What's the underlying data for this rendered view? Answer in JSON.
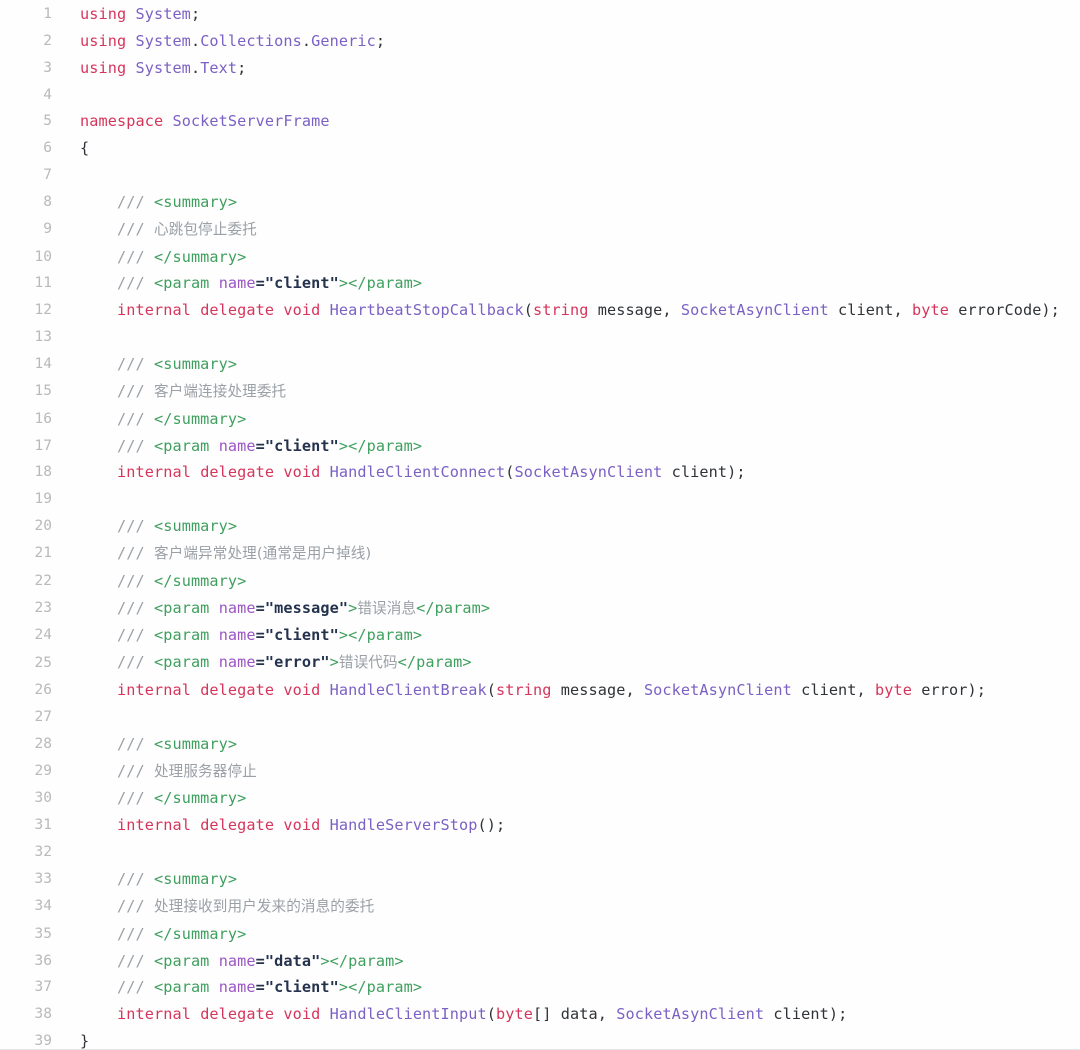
{
  "viewer": {
    "language": "csharp",
    "background": "#fefefe",
    "gutter_color": "#b9b9b9",
    "border_color": "#e4e4e4",
    "first_line": 1,
    "last_line": 39,
    "total_lines": 39
  },
  "colors": {
    "keyword": "#d6355b",
    "type": "#7b61c4",
    "punctuation": "#2f3337",
    "comment": "#9aa0a6",
    "doc_tag": "#3f9f5e",
    "doc_attribute": "#9b55c4",
    "string": "#24324d"
  },
  "lines": [
    {
      "n": "1",
      "text": "using System;"
    },
    {
      "n": "2",
      "text": "using System.Collections.Generic;"
    },
    {
      "n": "3",
      "text": "using System.Text;"
    },
    {
      "n": "4",
      "text": ""
    },
    {
      "n": "5",
      "text": "namespace SocketServerFrame"
    },
    {
      "n": "6",
      "text": "{"
    },
    {
      "n": "7",
      "text": ""
    },
    {
      "n": "8",
      "text": "    /// <summary>"
    },
    {
      "n": "9",
      "text": "    /// 心跳包停止委托"
    },
    {
      "n": "10",
      "text": "    /// </summary>"
    },
    {
      "n": "11",
      "text": "    /// <param name=\"client\"></param>"
    },
    {
      "n": "12",
      "text": "    internal delegate void HeartbeatStopCallback(string message, SocketAsynClient client, byte errorCode);"
    },
    {
      "n": "13",
      "text": ""
    },
    {
      "n": "14",
      "text": "    /// <summary>"
    },
    {
      "n": "15",
      "text": "    /// 客户端连接处理委托"
    },
    {
      "n": "16",
      "text": "    /// </summary>"
    },
    {
      "n": "17",
      "text": "    /// <param name=\"client\"></param>"
    },
    {
      "n": "18",
      "text": "    internal delegate void HandleClientConnect(SocketAsynClient client);"
    },
    {
      "n": "19",
      "text": ""
    },
    {
      "n": "20",
      "text": "    /// <summary>"
    },
    {
      "n": "21",
      "text": "    /// 客户端异常处理(通常是用户掉线)"
    },
    {
      "n": "22",
      "text": "    /// </summary>"
    },
    {
      "n": "23",
      "text": "    /// <param name=\"message\">错误消息</param>"
    },
    {
      "n": "24",
      "text": "    /// <param name=\"client\"></param>"
    },
    {
      "n": "25",
      "text": "    /// <param name=\"error\">错误代码</param>"
    },
    {
      "n": "26",
      "text": "    internal delegate void HandleClientBreak(string message, SocketAsynClient client, byte error);"
    },
    {
      "n": "27",
      "text": ""
    },
    {
      "n": "28",
      "text": "    /// <summary>"
    },
    {
      "n": "29",
      "text": "    /// 处理服务器停止"
    },
    {
      "n": "30",
      "text": "    /// </summary>"
    },
    {
      "n": "31",
      "text": "    internal delegate void HandleServerStop();"
    },
    {
      "n": "32",
      "text": ""
    },
    {
      "n": "33",
      "text": "    /// <summary>"
    },
    {
      "n": "34",
      "text": "    /// 处理接收到用户发来的消息的委托"
    },
    {
      "n": "35",
      "text": "    /// </summary>"
    },
    {
      "n": "36",
      "text": "    /// <param name=\"data\"></param>"
    },
    {
      "n": "37",
      "text": "    /// <param name=\"client\"></param>"
    },
    {
      "n": "38",
      "text": "    internal delegate void HandleClientInput(byte[] data, SocketAsynClient client);"
    },
    {
      "n": "39",
      "text": "}"
    }
  ],
  "tokens": [
    {
      "n": "1",
      "parts": [
        [
          "kw",
          "using"
        ],
        [
          "pun",
          " "
        ],
        [
          "typ",
          "System"
        ],
        [
          "pun",
          ";"
        ]
      ]
    },
    {
      "n": "2",
      "parts": [
        [
          "kw",
          "using"
        ],
        [
          "pun",
          " "
        ],
        [
          "typ",
          "System"
        ],
        [
          "pun",
          "."
        ],
        [
          "typ",
          "Collections"
        ],
        [
          "pun",
          "."
        ],
        [
          "typ",
          "Generic"
        ],
        [
          "pun",
          ";"
        ]
      ]
    },
    {
      "n": "3",
      "parts": [
        [
          "kw",
          "using"
        ],
        [
          "pun",
          " "
        ],
        [
          "typ",
          "System"
        ],
        [
          "pun",
          "."
        ],
        [
          "typ",
          "Text"
        ],
        [
          "pun",
          ";"
        ]
      ]
    },
    {
      "n": "4",
      "parts": []
    },
    {
      "n": "5",
      "parts": [
        [
          "kw",
          "namespace"
        ],
        [
          "pun",
          " "
        ],
        [
          "typ",
          "SocketServerFrame"
        ]
      ]
    },
    {
      "n": "6",
      "parts": [
        [
          "pun",
          "{"
        ]
      ]
    },
    {
      "n": "7",
      "parts": []
    },
    {
      "n": "8",
      "parts": [
        [
          "pun",
          "    "
        ],
        [
          "cmt",
          "/// "
        ],
        [
          "tag",
          "<summary>"
        ]
      ]
    },
    {
      "n": "9",
      "parts": [
        [
          "pun",
          "    "
        ],
        [
          "cmt",
          "/// "
        ],
        [
          "cjkcmt",
          "心跳包停止委托"
        ]
      ]
    },
    {
      "n": "10",
      "parts": [
        [
          "pun",
          "    "
        ],
        [
          "cmt",
          "/// "
        ],
        [
          "tag",
          "</summary>"
        ]
      ]
    },
    {
      "n": "11",
      "parts": [
        [
          "pun",
          "    "
        ],
        [
          "cmt",
          "/// "
        ],
        [
          "tag",
          "<param "
        ],
        [
          "attr",
          "name"
        ],
        [
          "str",
          "=\"client\""
        ],
        [
          "tag",
          "></param>"
        ]
      ]
    },
    {
      "n": "12",
      "parts": [
        [
          "pun",
          "    "
        ],
        [
          "kw",
          "internal"
        ],
        [
          "pun",
          " "
        ],
        [
          "kw",
          "delegate"
        ],
        [
          "pun",
          " "
        ],
        [
          "kw",
          "void"
        ],
        [
          "pun",
          " "
        ],
        [
          "typ",
          "HeartbeatStopCallback"
        ],
        [
          "pun",
          "("
        ],
        [
          "kw",
          "string"
        ],
        [
          "pun",
          " message, "
        ],
        [
          "typ",
          "SocketAsynClient"
        ],
        [
          "pun",
          " client, "
        ],
        [
          "kw",
          "byte"
        ],
        [
          "pun",
          " errorCode);"
        ]
      ]
    },
    {
      "n": "13",
      "parts": []
    },
    {
      "n": "14",
      "parts": [
        [
          "pun",
          "    "
        ],
        [
          "cmt",
          "/// "
        ],
        [
          "tag",
          "<summary>"
        ]
      ]
    },
    {
      "n": "15",
      "parts": [
        [
          "pun",
          "    "
        ],
        [
          "cmt",
          "/// "
        ],
        [
          "cjkcmt",
          "客户端连接处理委托"
        ]
      ]
    },
    {
      "n": "16",
      "parts": [
        [
          "pun",
          "    "
        ],
        [
          "cmt",
          "/// "
        ],
        [
          "tag",
          "</summary>"
        ]
      ]
    },
    {
      "n": "17",
      "parts": [
        [
          "pun",
          "    "
        ],
        [
          "cmt",
          "/// "
        ],
        [
          "tag",
          "<param "
        ],
        [
          "attr",
          "name"
        ],
        [
          "str",
          "=\"client\""
        ],
        [
          "tag",
          "></param>"
        ]
      ]
    },
    {
      "n": "18",
      "parts": [
        [
          "pun",
          "    "
        ],
        [
          "kw",
          "internal"
        ],
        [
          "pun",
          " "
        ],
        [
          "kw",
          "delegate"
        ],
        [
          "pun",
          " "
        ],
        [
          "kw",
          "void"
        ],
        [
          "pun",
          " "
        ],
        [
          "typ",
          "HandleClientConnect"
        ],
        [
          "pun",
          "("
        ],
        [
          "typ",
          "SocketAsynClient"
        ],
        [
          "pun",
          " client);"
        ]
      ]
    },
    {
      "n": "19",
      "parts": []
    },
    {
      "n": "20",
      "parts": [
        [
          "pun",
          "    "
        ],
        [
          "cmt",
          "/// "
        ],
        [
          "tag",
          "<summary>"
        ]
      ]
    },
    {
      "n": "21",
      "parts": [
        [
          "pun",
          "    "
        ],
        [
          "cmt",
          "/// "
        ],
        [
          "cjkcmt",
          "客户端异常处理(通常是用户掉线)"
        ]
      ]
    },
    {
      "n": "22",
      "parts": [
        [
          "pun",
          "    "
        ],
        [
          "cmt",
          "/// "
        ],
        [
          "tag",
          "</summary>"
        ]
      ]
    },
    {
      "n": "23",
      "parts": [
        [
          "pun",
          "    "
        ],
        [
          "cmt",
          "/// "
        ],
        [
          "tag",
          "<param "
        ],
        [
          "attr",
          "name"
        ],
        [
          "str",
          "=\"message\""
        ],
        [
          "tag",
          ">"
        ],
        [
          "cjkcmt",
          "错误消息"
        ],
        [
          "tag",
          "</param>"
        ]
      ]
    },
    {
      "n": "24",
      "parts": [
        [
          "pun",
          "    "
        ],
        [
          "cmt",
          "/// "
        ],
        [
          "tag",
          "<param "
        ],
        [
          "attr",
          "name"
        ],
        [
          "str",
          "=\"client\""
        ],
        [
          "tag",
          "></param>"
        ]
      ]
    },
    {
      "n": "25",
      "parts": [
        [
          "pun",
          "    "
        ],
        [
          "cmt",
          "/// "
        ],
        [
          "tag",
          "<param "
        ],
        [
          "attr",
          "name"
        ],
        [
          "str",
          "=\"error\""
        ],
        [
          "tag",
          ">"
        ],
        [
          "cjkcmt",
          "错误代码"
        ],
        [
          "tag",
          "</param>"
        ]
      ]
    },
    {
      "n": "26",
      "parts": [
        [
          "pun",
          "    "
        ],
        [
          "kw",
          "internal"
        ],
        [
          "pun",
          " "
        ],
        [
          "kw",
          "delegate"
        ],
        [
          "pun",
          " "
        ],
        [
          "kw",
          "void"
        ],
        [
          "pun",
          " "
        ],
        [
          "typ",
          "HandleClientBreak"
        ],
        [
          "pun",
          "("
        ],
        [
          "kw",
          "string"
        ],
        [
          "pun",
          " message, "
        ],
        [
          "typ",
          "SocketAsynClient"
        ],
        [
          "pun",
          " client, "
        ],
        [
          "kw",
          "byte"
        ],
        [
          "pun",
          " error);"
        ]
      ]
    },
    {
      "n": "27",
      "parts": []
    },
    {
      "n": "28",
      "parts": [
        [
          "pun",
          "    "
        ],
        [
          "cmt",
          "/// "
        ],
        [
          "tag",
          "<summary>"
        ]
      ]
    },
    {
      "n": "29",
      "parts": [
        [
          "pun",
          "    "
        ],
        [
          "cmt",
          "/// "
        ],
        [
          "cjkcmt",
          "处理服务器停止"
        ]
      ]
    },
    {
      "n": "30",
      "parts": [
        [
          "pun",
          "    "
        ],
        [
          "cmt",
          "/// "
        ],
        [
          "tag",
          "</summary>"
        ]
      ]
    },
    {
      "n": "31",
      "parts": [
        [
          "pun",
          "    "
        ],
        [
          "kw",
          "internal"
        ],
        [
          "pun",
          " "
        ],
        [
          "kw",
          "delegate"
        ],
        [
          "pun",
          " "
        ],
        [
          "kw",
          "void"
        ],
        [
          "pun",
          " "
        ],
        [
          "typ",
          "HandleServerStop"
        ],
        [
          "pun",
          "();"
        ]
      ]
    },
    {
      "n": "32",
      "parts": []
    },
    {
      "n": "33",
      "parts": [
        [
          "pun",
          "    "
        ],
        [
          "cmt",
          "/// "
        ],
        [
          "tag",
          "<summary>"
        ]
      ]
    },
    {
      "n": "34",
      "parts": [
        [
          "pun",
          "    "
        ],
        [
          "cmt",
          "/// "
        ],
        [
          "cjkcmt",
          "处理接收到用户发来的消息的委托"
        ]
      ]
    },
    {
      "n": "35",
      "parts": [
        [
          "pun",
          "    "
        ],
        [
          "cmt",
          "/// "
        ],
        [
          "tag",
          "</summary>"
        ]
      ]
    },
    {
      "n": "36",
      "parts": [
        [
          "pun",
          "    "
        ],
        [
          "cmt",
          "/// "
        ],
        [
          "tag",
          "<param "
        ],
        [
          "attr",
          "name"
        ],
        [
          "str",
          "=\"data\""
        ],
        [
          "tag",
          "></param>"
        ]
      ]
    },
    {
      "n": "37",
      "parts": [
        [
          "pun",
          "    "
        ],
        [
          "cmt",
          "/// "
        ],
        [
          "tag",
          "<param "
        ],
        [
          "attr",
          "name"
        ],
        [
          "str",
          "=\"client\""
        ],
        [
          "tag",
          "></param>"
        ]
      ]
    },
    {
      "n": "38",
      "parts": [
        [
          "pun",
          "    "
        ],
        [
          "kw",
          "internal"
        ],
        [
          "pun",
          " "
        ],
        [
          "kw",
          "delegate"
        ],
        [
          "pun",
          " "
        ],
        [
          "kw",
          "void"
        ],
        [
          "pun",
          " "
        ],
        [
          "typ",
          "HandleClientInput"
        ],
        [
          "pun",
          "("
        ],
        [
          "kw",
          "byte"
        ],
        [
          "pun",
          "[] data, "
        ],
        [
          "typ",
          "SocketAsynClient"
        ],
        [
          "pun",
          " client);"
        ]
      ]
    },
    {
      "n": "39",
      "parts": [
        [
          "pun",
          "}"
        ]
      ]
    }
  ]
}
